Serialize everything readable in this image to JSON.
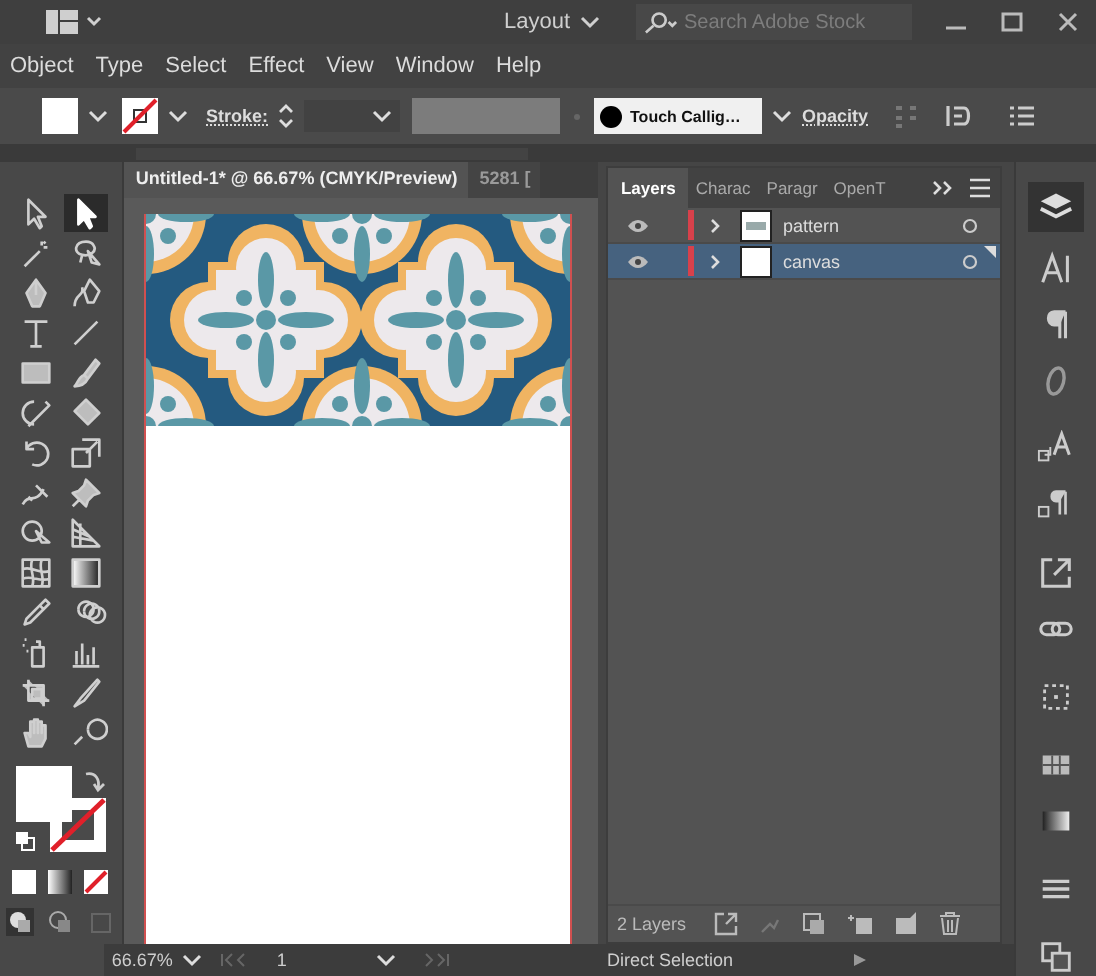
{
  "title_bar": {
    "workspace": "Layout",
    "search": {
      "placeholder": "Search Adobe Stock"
    }
  },
  "menu": [
    "Object",
    "Type",
    "Select",
    "Effect",
    "View",
    "Window",
    "Help"
  ],
  "control_bar": {
    "stroke_label": "Stroke:",
    "brush": "Touch Callig…",
    "opacity_label": "Opacity"
  },
  "document_tabs": [
    {
      "label": "Untitled-1* @ 66.67% (CMYK/Preview)",
      "selected": true
    },
    {
      "label": "5281 [",
      "selected": false
    }
  ],
  "tools": [
    {
      "kind": "select",
      "selected": false
    },
    {
      "kind": "direct-select",
      "selected": true
    },
    {
      "kind": "magic-wand",
      "selected": false
    },
    {
      "kind": "lasso",
      "selected": false
    },
    {
      "kind": "pen",
      "selected": false
    },
    {
      "kind": "curvature",
      "selected": false
    },
    {
      "kind": "type",
      "selected": false
    },
    {
      "kind": "line",
      "selected": false
    },
    {
      "kind": "rectangle",
      "selected": false
    },
    {
      "kind": "brush",
      "selected": false
    },
    {
      "kind": "shaper",
      "selected": false
    },
    {
      "kind": "eraser",
      "selected": false
    },
    {
      "kind": "rotate",
      "selected": false
    },
    {
      "kind": "scale",
      "selected": false
    },
    {
      "kind": "width",
      "selected": false
    },
    {
      "kind": "pin",
      "selected": false
    },
    {
      "kind": "shape-builder",
      "selected": false
    },
    {
      "kind": "perspective",
      "selected": false
    },
    {
      "kind": "mesh",
      "selected": false
    },
    {
      "kind": "gradient",
      "selected": false
    },
    {
      "kind": "eyedropper",
      "selected": false
    },
    {
      "kind": "blend",
      "selected": false
    },
    {
      "kind": "sprayer",
      "selected": false
    },
    {
      "kind": "graph",
      "selected": false
    },
    {
      "kind": "artboard",
      "selected": false
    },
    {
      "kind": "slice",
      "selected": false
    },
    {
      "kind": "hand",
      "selected": false
    },
    {
      "kind": "zoom",
      "selected": false
    }
  ],
  "layers_panel": {
    "tabs": [
      {
        "label": "Layers",
        "selected": true
      },
      {
        "label": "Charac",
        "selected": false
      },
      {
        "label": "Paragr",
        "selected": false
      },
      {
        "label": "OpenT",
        "selected": false
      }
    ],
    "layers": [
      {
        "name": "pattern",
        "kind": "pattern",
        "selected": false,
        "visible": true,
        "expanded": false
      },
      {
        "name": "canvas",
        "kind": "blank",
        "selected": true,
        "visible": true,
        "expanded": false
      }
    ],
    "count": "2 Layers"
  },
  "status_bar": {
    "zoom": "66.67%",
    "artboard": "1",
    "tool": "Direct Selection"
  }
}
